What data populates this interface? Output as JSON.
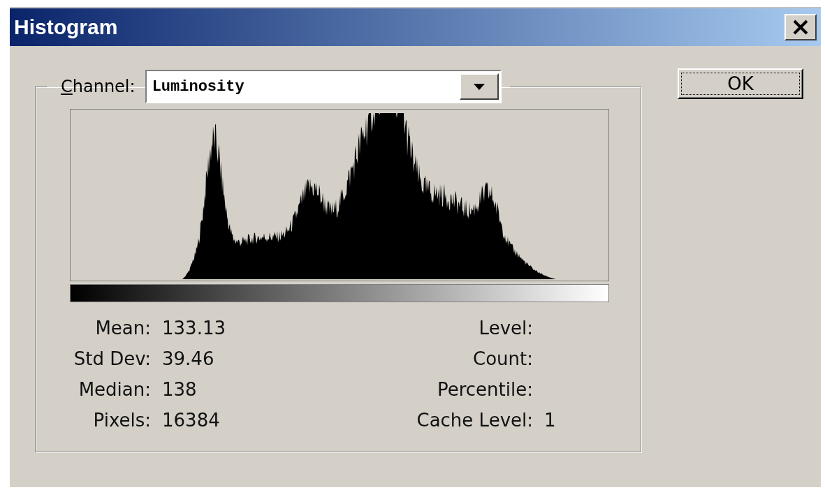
{
  "window": {
    "title": "Histogram"
  },
  "channel": {
    "label": "Channel:",
    "value": "Luminosity"
  },
  "buttons": [
    "OK"
  ],
  "stats_left": [
    {
      "label": "Mean:",
      "value": "133.13"
    },
    {
      "label": "Std Dev:",
      "value": "39.46"
    },
    {
      "label": "Median:",
      "value": "138"
    },
    {
      "label": "Pixels:",
      "value": "16384"
    }
  ],
  "stats_right": [
    {
      "label": "Level:"
    },
    {
      "label": "Count:"
    },
    {
      "label": "Percentile:"
    },
    {
      "label": "Cache Level:",
      "value": "1"
    }
  ]
}
